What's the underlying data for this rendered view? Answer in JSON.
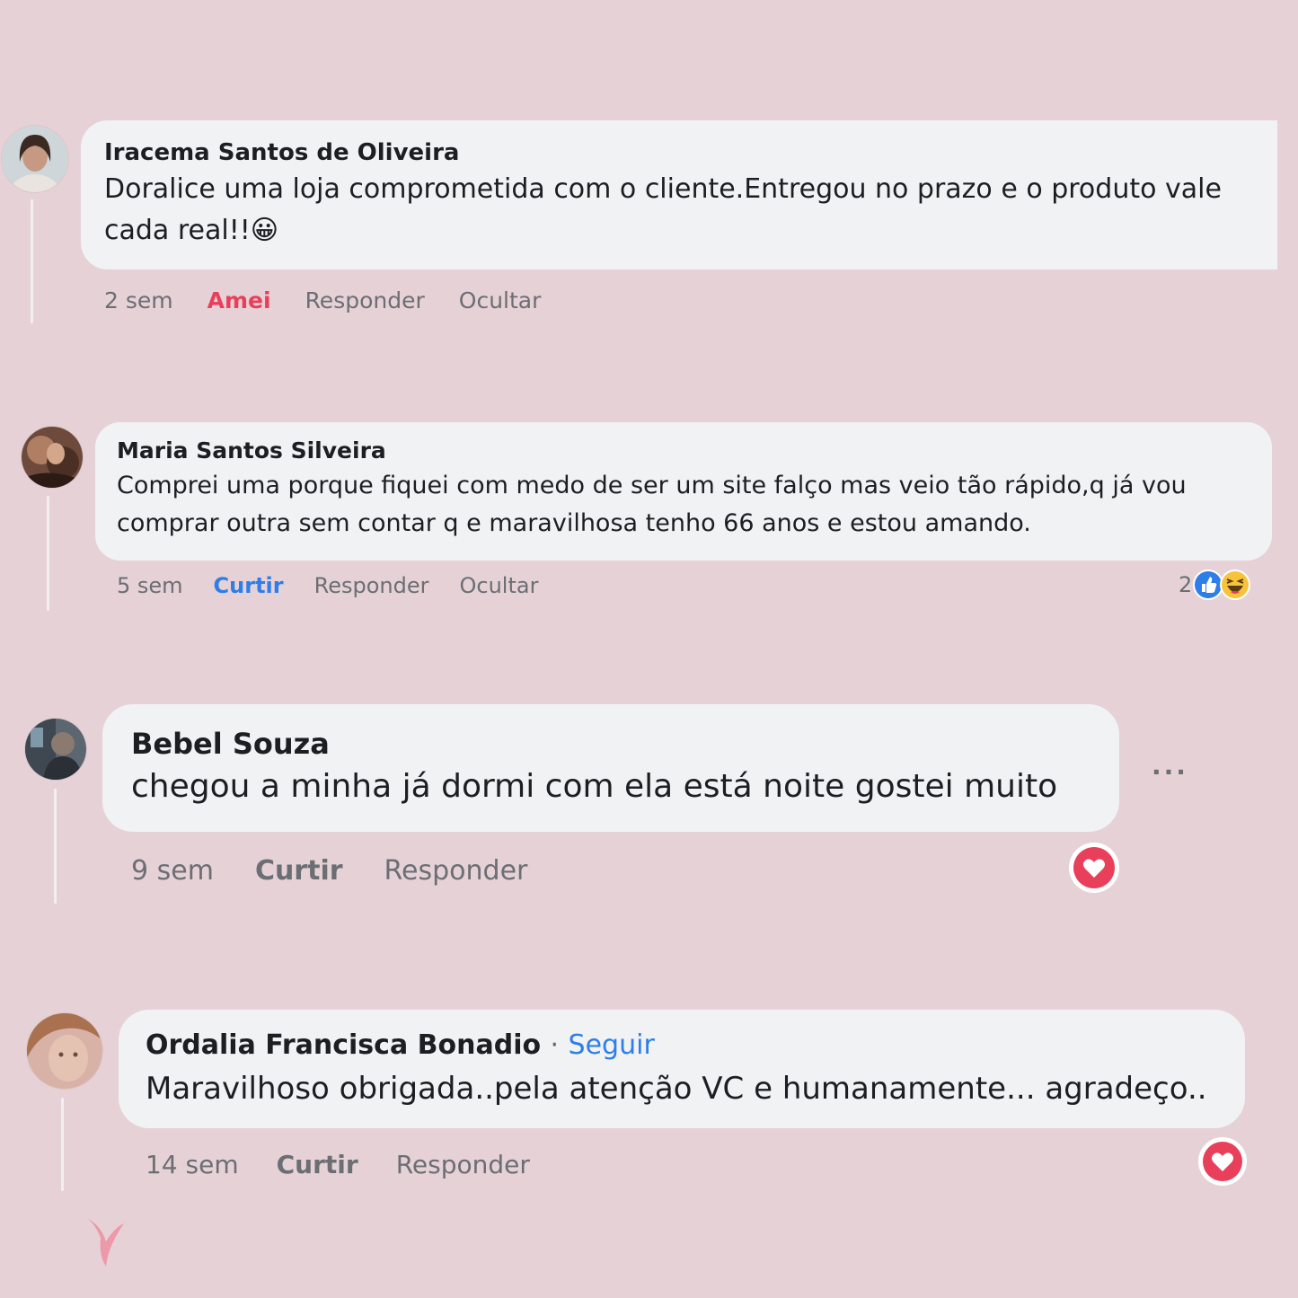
{
  "colors": {
    "background": "#e6d2d6",
    "bubble": "#f1f2f4",
    "love_red": "#e8405b",
    "like_blue": "#2d7ee8",
    "muted": "#6b6e73"
  },
  "comments": [
    {
      "author": "Iracema Santos de Oliveira",
      "text": "Doralice uma loja comprometida com o cliente.Entregou no prazo e o produto vale cada real!!",
      "emoji": "😀",
      "time": "2 sem",
      "reaction_label": "Amei",
      "reply": "Responder",
      "hide": "Ocultar"
    },
    {
      "author": "Maria Santos Silveira",
      "text": "Comprei uma porque fiquei com medo de ser um site falço mas veio tão rápido,q já vou comprar outra sem contar q e maravilhosa tenho 66 anos e estou amando.",
      "time": "5 sem",
      "reaction_label": "Curtir",
      "reply": "Responder",
      "hide": "Ocultar",
      "reaction_count": "2",
      "reaction_icons": [
        "like-icon",
        "haha-icon"
      ]
    },
    {
      "author": "Bebel Souza",
      "text": "chegou a minha já dormi com ela está noite gostei muito",
      "time": "9 sem",
      "reaction_label": "Curtir",
      "reply": "Responder",
      "more": "...",
      "reaction_icons": [
        "love-icon"
      ]
    },
    {
      "author": "Ordalia Francisca Bonadio",
      "separator": "·",
      "follow": "Seguir",
      "text": "Maravilhoso obrigada..pela atenção VC e humanamente... agradeço..",
      "time": "14 sem",
      "reaction_label": "Curtir",
      "reply": "Responder",
      "reaction_icons": [
        "love-icon"
      ]
    }
  ]
}
